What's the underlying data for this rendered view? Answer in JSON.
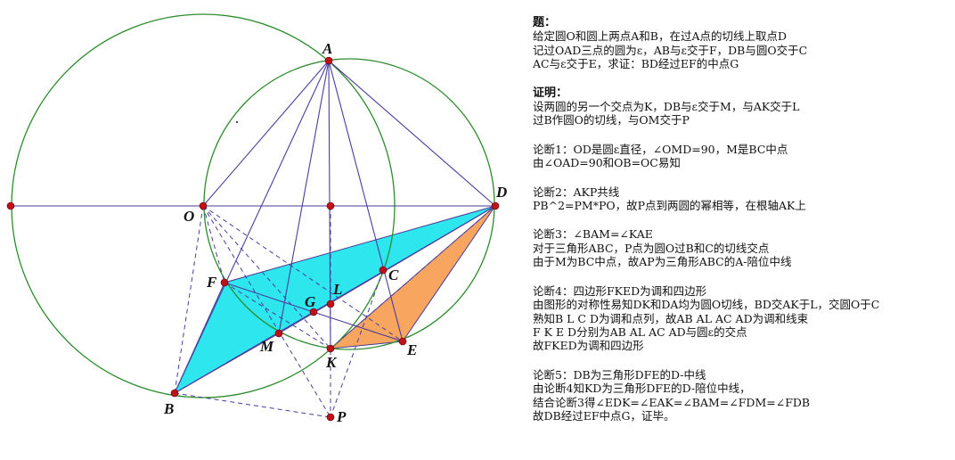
{
  "figure": {
    "labels": {
      "A": "A",
      "B": "B",
      "C": "C",
      "D": "D",
      "E": "E",
      "F": "F",
      "G": "G",
      "K": "K",
      "L": "L",
      "M": "M",
      "O": "O",
      "P": "P"
    },
    "colors": {
      "circle": "#2e8b2e",
      "line": "#4a3d9a",
      "point": "#c0111b",
      "cyan_fill": "#2ee6ee",
      "orange_fill": "#f7a55f"
    }
  },
  "problem": {
    "heading": "题：",
    "lines": [
      "给定圆O和圆上两点A和B，在过A点的切线上取点D",
      "记过OAD三点的圆为ε，AB与ε交于F，DB与圆O交于C",
      "AC与ε交于E，求证：BD经过EF的中点G"
    ]
  },
  "proof": {
    "heading": "证明：",
    "lines": [
      "设两圆的另一个交点为K，DB与ε交于M，与AK交于L",
      "过B作圆O的切线，与OM交于P"
    ]
  },
  "steps": [
    {
      "title": "论断1：OD是圆ε直径，∠OMD=90，M是BC中点",
      "lines": [
        "由∠OAD=90和OB=OC易知"
      ]
    },
    {
      "title": "论断2：AKP共线",
      "lines": [
        "PB^2=PM*PO，故P点到两圆的幂相等，在根轴AK上"
      ]
    },
    {
      "title": "论断3：∠BAM=∠KAE",
      "lines": [
        "对于三角形ABC，P点为圆O过B和C的切线交点",
        "由于M为BC中点，故AP为三角形ABC的A-陪位中线"
      ]
    },
    {
      "title": "论断4：四边形FKED为调和四边形",
      "lines": [
        "由图形的对称性易知DK和DA均为圆O切线，BD交AK于L，交圆O于C",
        "熟知B L C D为调和点列，故AB AL AC AD为调和线束",
        "F K E D分别为AB AL AC AD与圆ε的交点",
        "故FKED为调和四边形"
      ]
    },
    {
      "title": "论断5：DB为三角形DFE的D-中线",
      "lines": [
        "由论断4知KD为三角形DFE的D-陪位中线，",
        "结合论断3得∠EDK=∠EAK=∠BAM=∠FDM=∠FDB",
        "故DB经过EF中点G，证毕。"
      ]
    }
  ]
}
